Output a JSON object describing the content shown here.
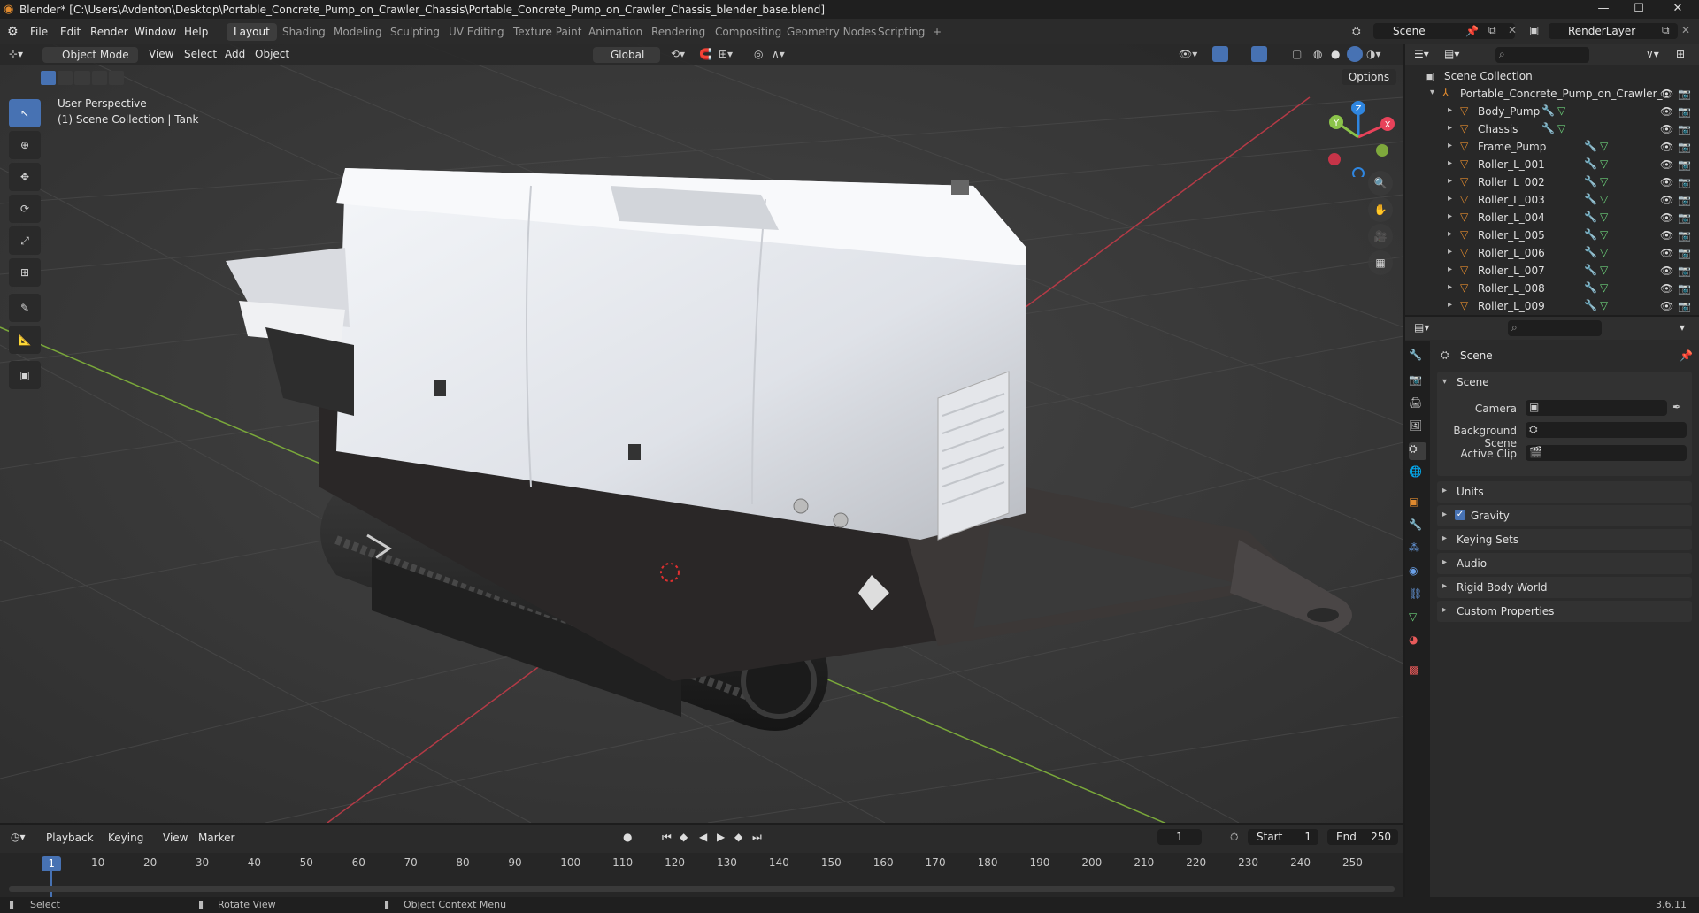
{
  "window": {
    "title": "Blender* [C:\\Users\\Avdenton\\Desktop\\Portable_Concrete_Pump_on_Crawler_Chassis\\Portable_Concrete_Pump_on_Crawler_Chassis_blender_base.blend]",
    "minimize": "—",
    "maximize": "☐",
    "close": "✕"
  },
  "menu": [
    "File",
    "Edit",
    "Render",
    "Window",
    "Help"
  ],
  "workspaces": [
    "Layout",
    "Shading",
    "Modeling",
    "Sculpting",
    "UV Editing",
    "Texture Paint",
    "Animation",
    "Rendering",
    "Compositing",
    "Geometry Nodes",
    "Scripting",
    "+"
  ],
  "active_workspace": "Layout",
  "scene_field": "Scene",
  "renderlayer_field": "RenderLayer",
  "viewport_header": {
    "mode": "Object Mode",
    "menus": [
      "View",
      "Select",
      "Add",
      "Object"
    ],
    "transform_orientation": "Global",
    "options": "Options"
  },
  "viewport_overlay": {
    "perspective": "User Perspective",
    "collection_info": "(1) Scene Collection | Tank"
  },
  "gizmo": {
    "x": "X",
    "y": "Y",
    "z": "Z"
  },
  "outliner": {
    "root": "Scene Collection",
    "collection": "Portable_Concrete_Pump_on_Crawler_C",
    "objects": [
      "Body_Pump",
      "Chassis",
      "Frame_Pump",
      "Roller_L_001",
      "Roller_L_002",
      "Roller_L_003",
      "Roller_L_004",
      "Roller_L_005",
      "Roller_L_006",
      "Roller_L_007",
      "Roller_L_008",
      "Roller_L_009"
    ]
  },
  "properties": {
    "header": "Scene",
    "section": "Scene",
    "fields": [
      {
        "label": "Camera",
        "value": ""
      },
      {
        "label": "Background Scene",
        "value": ""
      },
      {
        "label": "Active Clip",
        "value": ""
      }
    ],
    "panels": [
      "Units",
      "Gravity",
      "Keying Sets",
      "Audio",
      "Rigid Body World",
      "Custom Properties"
    ],
    "gravity_checked": true
  },
  "timeline": {
    "menus": [
      "Playback",
      "Keying",
      "View",
      "Marker"
    ],
    "current_frame": "1",
    "start_label": "Start",
    "start": "1",
    "end_label": "End",
    "end": "250",
    "ticks": [
      "1",
      "10",
      "20",
      "30",
      "40",
      "50",
      "60",
      "70",
      "80",
      "90",
      "100",
      "110",
      "120",
      "130",
      "140",
      "150",
      "160",
      "170",
      "180",
      "190",
      "200",
      "210",
      "220",
      "230",
      "240",
      "250"
    ]
  },
  "statusbar": {
    "select": "Select",
    "rotate": "Rotate View",
    "context": "Object Context Menu",
    "version": "3.6.11"
  },
  "colors": {
    "accent": "#4772b3",
    "x_axis": "#e8425a",
    "y_axis": "#8bc34a",
    "z_axis": "#2f86e0"
  }
}
